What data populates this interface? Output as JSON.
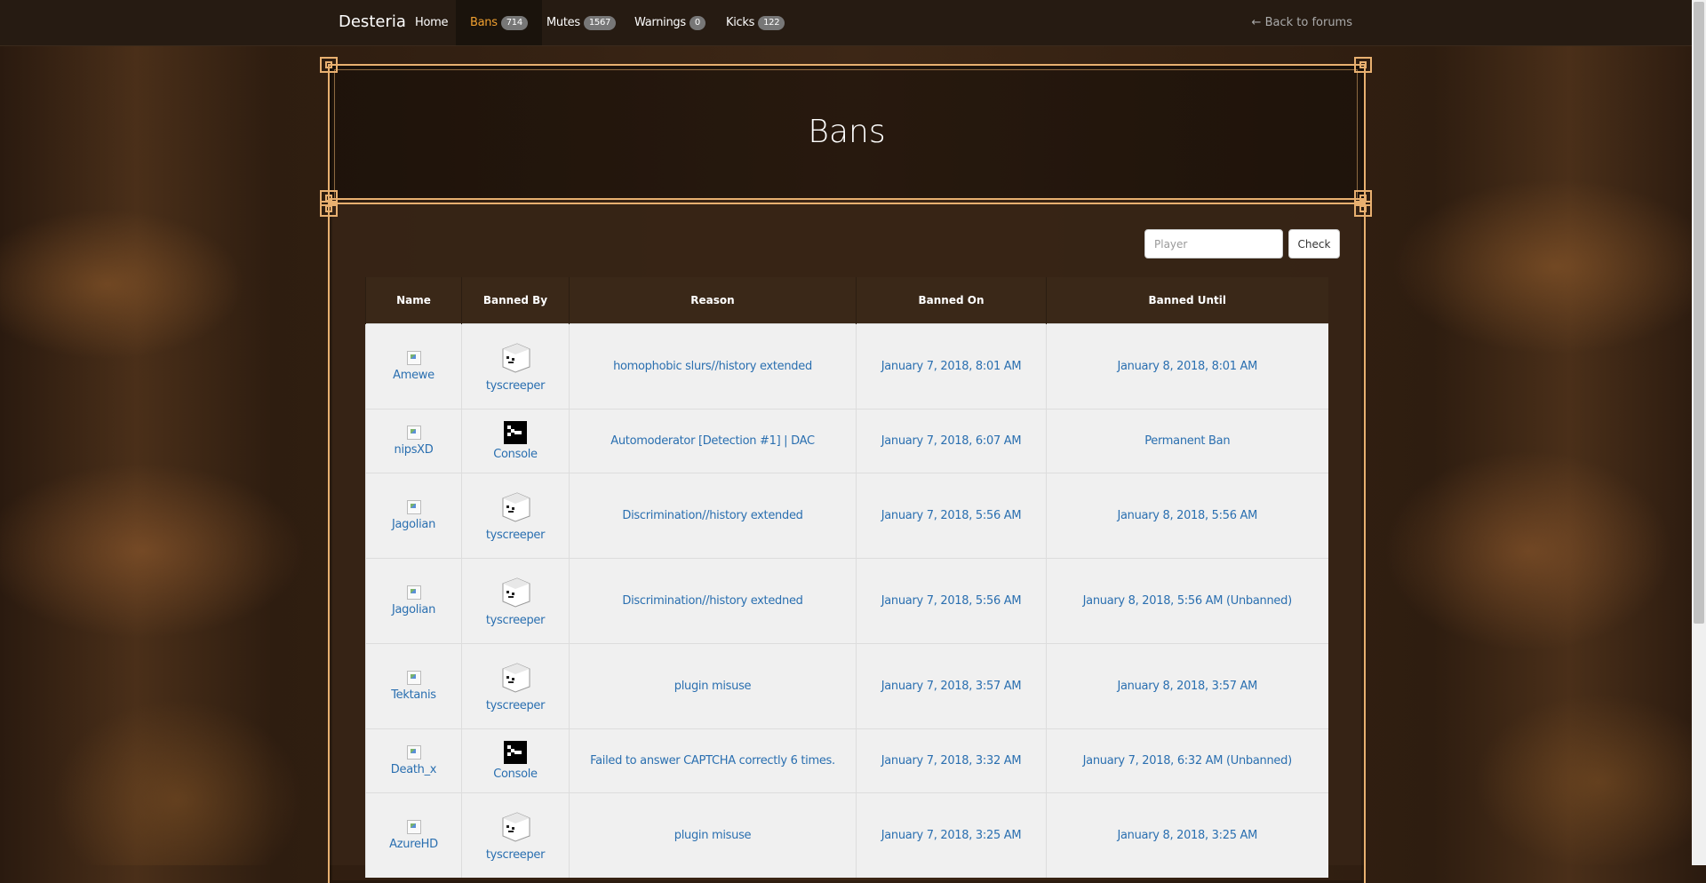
{
  "nav": {
    "brand": "Desteria",
    "items": [
      {
        "label": "Home",
        "badge": ""
      },
      {
        "label": "Bans",
        "badge": "714"
      },
      {
        "label": "Mutes",
        "badge": "1567"
      },
      {
        "label": "Warnings",
        "badge": "0"
      },
      {
        "label": "Kicks",
        "badge": "122"
      }
    ],
    "back": "← Back to forums"
  },
  "page": {
    "title": "Bans"
  },
  "search": {
    "placeholder": "Player",
    "button": "Check"
  },
  "table": {
    "headers": [
      "Name",
      "Banned By",
      "Reason",
      "Banned On",
      "Banned Until"
    ],
    "rows": [
      {
        "name": "Amewe",
        "by": "tyscreeper",
        "reason": "homophobic slurs//history extended",
        "on": "January 7, 2018, 8:01 AM",
        "until": "January 8, 2018, 8:01 AM"
      },
      {
        "name": "nipsXD",
        "by": "Console",
        "reason": "Automoderator [Detection #1] | DAC",
        "on": "January 7, 2018, 6:07 AM",
        "until": "Permanent Ban"
      },
      {
        "name": "Jagolian",
        "by": "tyscreeper",
        "reason": "Discrimination//history extended",
        "on": "January 7, 2018, 5:56 AM",
        "until": "January 8, 2018, 5:56 AM"
      },
      {
        "name": "Jagolian",
        "by": "tyscreeper",
        "reason": "Discrimination//history extedned",
        "on": "January 7, 2018, 5:56 AM",
        "until": "January 8, 2018, 5:56 AM (Unbanned)"
      },
      {
        "name": "Tektanis",
        "by": "tyscreeper",
        "reason": "plugin misuse",
        "on": "January 7, 2018, 3:57 AM",
        "until": "January 8, 2018, 3:57 AM"
      },
      {
        "name": "Death_x",
        "by": "Console",
        "reason": "Failed to answer CAPTCHA correctly 6 times.",
        "on": "January 7, 2018, 3:32 AM",
        "until": "January 7, 2018, 6:32 AM (Unbanned)"
      },
      {
        "name": "AzureHD",
        "by": "tyscreeper",
        "reason": "plugin misuse",
        "on": "January 7, 2018, 3:25 AM",
        "until": "January 8, 2018, 3:25 AM"
      }
    ]
  },
  "colors": {
    "accent": "#f0a030",
    "frame": "#e8b070",
    "link": "#2a6fb0"
  }
}
